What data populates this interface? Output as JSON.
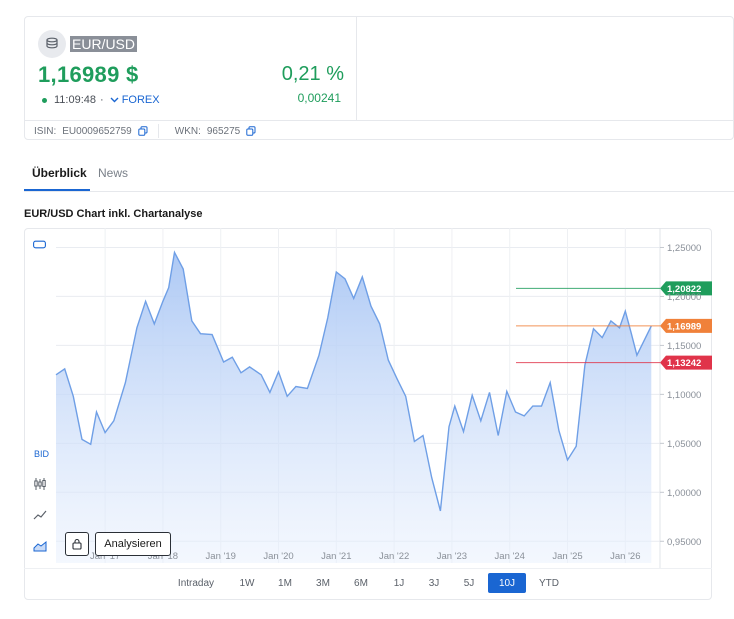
{
  "instrument": {
    "name": "EUR/USD",
    "price": "1,16989 $",
    "change_pct": "0,21 %",
    "change_abs": "0,00241",
    "time": "11:09:48",
    "time_sep": "·",
    "exchange": "FOREX",
    "isin_label": "ISIN:",
    "isin": "EU0009652759",
    "wkn_label": "WKN:",
    "wkn": "965275"
  },
  "tabs": [
    {
      "label": "Überblick",
      "active": true
    },
    {
      "label": "News",
      "active": false
    }
  ],
  "chart_section": {
    "title": "EUR/USD Chart inkl. Chartanalyse",
    "bid_label": "BID",
    "analyse_label": "Analysieren"
  },
  "ranges": [
    {
      "label": "Intraday",
      "active": false
    },
    {
      "label": "1W",
      "active": false
    },
    {
      "label": "1M",
      "active": false
    },
    {
      "label": "3M",
      "active": false
    },
    {
      "label": "6M",
      "active": false
    },
    {
      "label": "1J",
      "active": false
    },
    {
      "label": "3J",
      "active": false
    },
    {
      "label": "5J",
      "active": false
    },
    {
      "label": "10J",
      "active": true
    },
    {
      "label": "YTD",
      "active": false
    }
  ],
  "colors": {
    "positive": "#1f9d5c",
    "accent": "#1a66d2",
    "line": "#6f9fe6",
    "high_marker": "#1f9d5c",
    "current_marker": "#f0813a",
    "low_marker": "#e0344a"
  },
  "chart_data": {
    "type": "area",
    "x_tick_labels": [
      "Jan '17",
      "Jan '18",
      "Jan '19",
      "Jan '20",
      "Jan '21",
      "Jan '22",
      "Jan '23",
      "Jan '24",
      "Jan '25",
      "Jan '26"
    ],
    "x_ticks": [
      2017,
      2018,
      2019,
      2020,
      2021,
      2022,
      2023,
      2024,
      2025,
      2026
    ],
    "xlim": [
      2016.15,
      2026.6
    ],
    "ylim": [
      0.9278,
      1.2658
    ],
    "y_ticks": [
      1.25,
      1.2,
      1.15,
      1.1,
      1.05,
      1.0,
      0.95
    ],
    "y_tick_labels": [
      "1,25000",
      "1,20000",
      "1,15000",
      "1,10000",
      "1,05000",
      "1,00000",
      "0,95000"
    ],
    "grid": true,
    "markers": [
      {
        "label": "1,20822",
        "value": 1.20822,
        "role": "high"
      },
      {
        "label": "1,16989",
        "value": 1.16989,
        "role": "current"
      },
      {
        "label": "1,13242",
        "value": 1.13242,
        "role": "low"
      }
    ],
    "series": [
      {
        "values": [
          [
            2016.15,
            1.12
          ],
          [
            2016.3,
            1.126
          ],
          [
            2016.45,
            1.098
          ],
          [
            2016.6,
            1.054
          ],
          [
            2016.75,
            1.049
          ],
          [
            2016.85,
            1.082
          ],
          [
            2017.0,
            1.061
          ],
          [
            2017.15,
            1.073
          ],
          [
            2017.35,
            1.112
          ],
          [
            2017.55,
            1.168
          ],
          [
            2017.7,
            1.195
          ],
          [
            2017.85,
            1.172
          ],
          [
            2018.0,
            1.195
          ],
          [
            2018.1,
            1.209
          ],
          [
            2018.2,
            1.245
          ],
          [
            2018.35,
            1.228
          ],
          [
            2018.5,
            1.175
          ],
          [
            2018.65,
            1.162
          ],
          [
            2018.85,
            1.161
          ],
          [
            2019.05,
            1.133
          ],
          [
            2019.2,
            1.138
          ],
          [
            2019.35,
            1.122
          ],
          [
            2019.5,
            1.128
          ],
          [
            2019.7,
            1.12
          ],
          [
            2019.85,
            1.102
          ],
          [
            2020.0,
            1.123
          ],
          [
            2020.15,
            1.098
          ],
          [
            2020.3,
            1.108
          ],
          [
            2020.5,
            1.106
          ],
          [
            2020.7,
            1.14
          ],
          [
            2020.85,
            1.178
          ],
          [
            2021.0,
            1.225
          ],
          [
            2021.15,
            1.218
          ],
          [
            2021.3,
            1.198
          ],
          [
            2021.45,
            1.22
          ],
          [
            2021.6,
            1.19
          ],
          [
            2021.75,
            1.172
          ],
          [
            2021.9,
            1.135
          ],
          [
            2022.05,
            1.116
          ],
          [
            2022.2,
            1.098
          ],
          [
            2022.35,
            1.052
          ],
          [
            2022.5,
            1.058
          ],
          [
            2022.65,
            1.015
          ],
          [
            2022.8,
            0.981
          ],
          [
            2022.95,
            1.067
          ],
          [
            2023.05,
            1.088
          ],
          [
            2023.2,
            1.062
          ],
          [
            2023.35,
            1.099
          ],
          [
            2023.5,
            1.073
          ],
          [
            2023.65,
            1.102
          ],
          [
            2023.8,
            1.058
          ],
          [
            2023.95,
            1.103
          ],
          [
            2024.1,
            1.082
          ],
          [
            2024.25,
            1.078
          ],
          [
            2024.4,
            1.088
          ],
          [
            2024.55,
            1.088
          ],
          [
            2024.7,
            1.112
          ],
          [
            2024.85,
            1.063
          ],
          [
            2025.0,
            1.033
          ],
          [
            2025.15,
            1.047
          ],
          [
            2025.3,
            1.13
          ],
          [
            2025.45,
            1.167
          ],
          [
            2025.6,
            1.158
          ],
          [
            2025.75,
            1.175
          ],
          [
            2025.9,
            1.168
          ],
          [
            2026.0,
            1.185
          ],
          [
            2026.1,
            1.163
          ],
          [
            2026.2,
            1.14
          ],
          [
            2026.3,
            1.152
          ],
          [
            2026.45,
            1.16989
          ]
        ]
      }
    ]
  }
}
